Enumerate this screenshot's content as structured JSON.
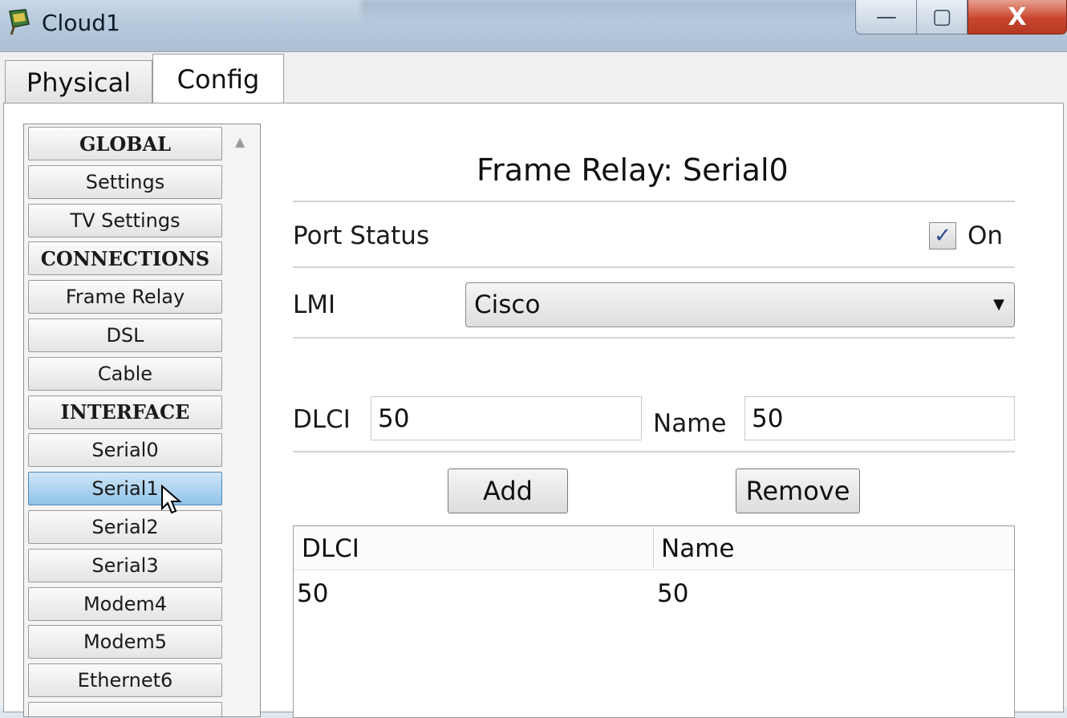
{
  "window": {
    "title": "Cloud1",
    "icon": "cloud-device-icon",
    "controls": {
      "minimize": "—",
      "maximize": "▢",
      "close": "X"
    }
  },
  "tabs": [
    {
      "label": "Physical",
      "active": false
    },
    {
      "label": "Config",
      "active": true
    }
  ],
  "sidebar": {
    "items": [
      {
        "label": "GLOBAL",
        "type": "header"
      },
      {
        "label": "Settings",
        "type": "item"
      },
      {
        "label": "TV Settings",
        "type": "item"
      },
      {
        "label": "CONNECTIONS",
        "type": "header"
      },
      {
        "label": "Frame Relay",
        "type": "item"
      },
      {
        "label": "DSL",
        "type": "item"
      },
      {
        "label": "Cable",
        "type": "item"
      },
      {
        "label": "INTERFACE",
        "type": "header"
      },
      {
        "label": "Serial0",
        "type": "item"
      },
      {
        "label": "Serial1",
        "type": "item",
        "selected": true
      },
      {
        "label": "Serial2",
        "type": "item"
      },
      {
        "label": "Serial3",
        "type": "item"
      },
      {
        "label": "Modem4",
        "type": "item"
      },
      {
        "label": "Modem5",
        "type": "item"
      },
      {
        "label": "Ethernet6",
        "type": "item"
      }
    ]
  },
  "main": {
    "title": "Frame Relay: Serial0",
    "port_status": {
      "label": "Port Status",
      "checkbox_label": "On",
      "checked": true
    },
    "lmi": {
      "label": "LMI",
      "selected": "Cisco"
    },
    "dlci_field": {
      "label": "DLCI",
      "value": "50"
    },
    "name_field": {
      "label": "Name",
      "value": "50"
    },
    "buttons": {
      "add": "Add",
      "remove": "Remove"
    },
    "table": {
      "headers": [
        "DLCI",
        "Name"
      ],
      "rows": [
        [
          "50",
          "50"
        ]
      ]
    }
  }
}
